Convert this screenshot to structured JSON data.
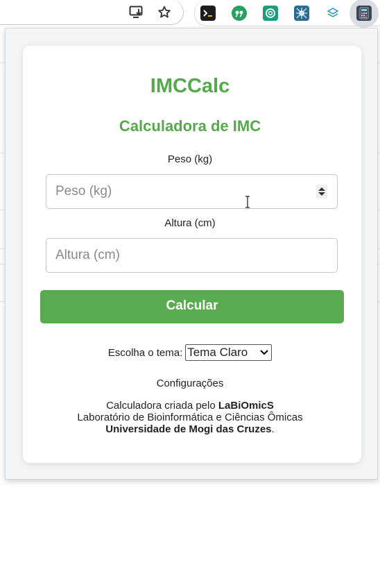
{
  "browser": {
    "icons": [
      "install-app-icon",
      "bookmark-star-icon"
    ],
    "extensions": [
      {
        "name": "terminal-extension-icon",
        "color": "#1d1d1d"
      },
      {
        "name": "quote-extension-icon",
        "color": "#27a060"
      },
      {
        "name": "chatgpt-extension-icon",
        "color": "#1f9c7c"
      },
      {
        "name": "network-extension-icon",
        "color": "#2b6d8e"
      },
      {
        "name": "layers-extension-icon",
        "color": "#3c9bd6"
      },
      {
        "name": "calculator-extension-icon",
        "color": "#3c4753"
      }
    ]
  },
  "app": {
    "title": "IMCCalc",
    "subtitle": "Calculadora de IMC",
    "accent_color": "#55a84c",
    "weight": {
      "label": "Peso (kg)",
      "placeholder": "Peso (kg)",
      "value": ""
    },
    "height": {
      "label": "Altura (cm)",
      "placeholder": "Altura (cm)",
      "value": ""
    },
    "calculate_label": "Calcular",
    "theme": {
      "label": "Escolha o tema:",
      "selected": "Tema Claro"
    },
    "settings_label": "Configurações",
    "credits": {
      "line1_prefix": "Calculadora criada pelo ",
      "line1_bold": "LaBiOmicS",
      "line2": "Laboratório de Bioinformática e Ciências Ômicas",
      "line3_bold": "Universidade de Mogi das Cruzes",
      "line3_suffix": "."
    }
  }
}
